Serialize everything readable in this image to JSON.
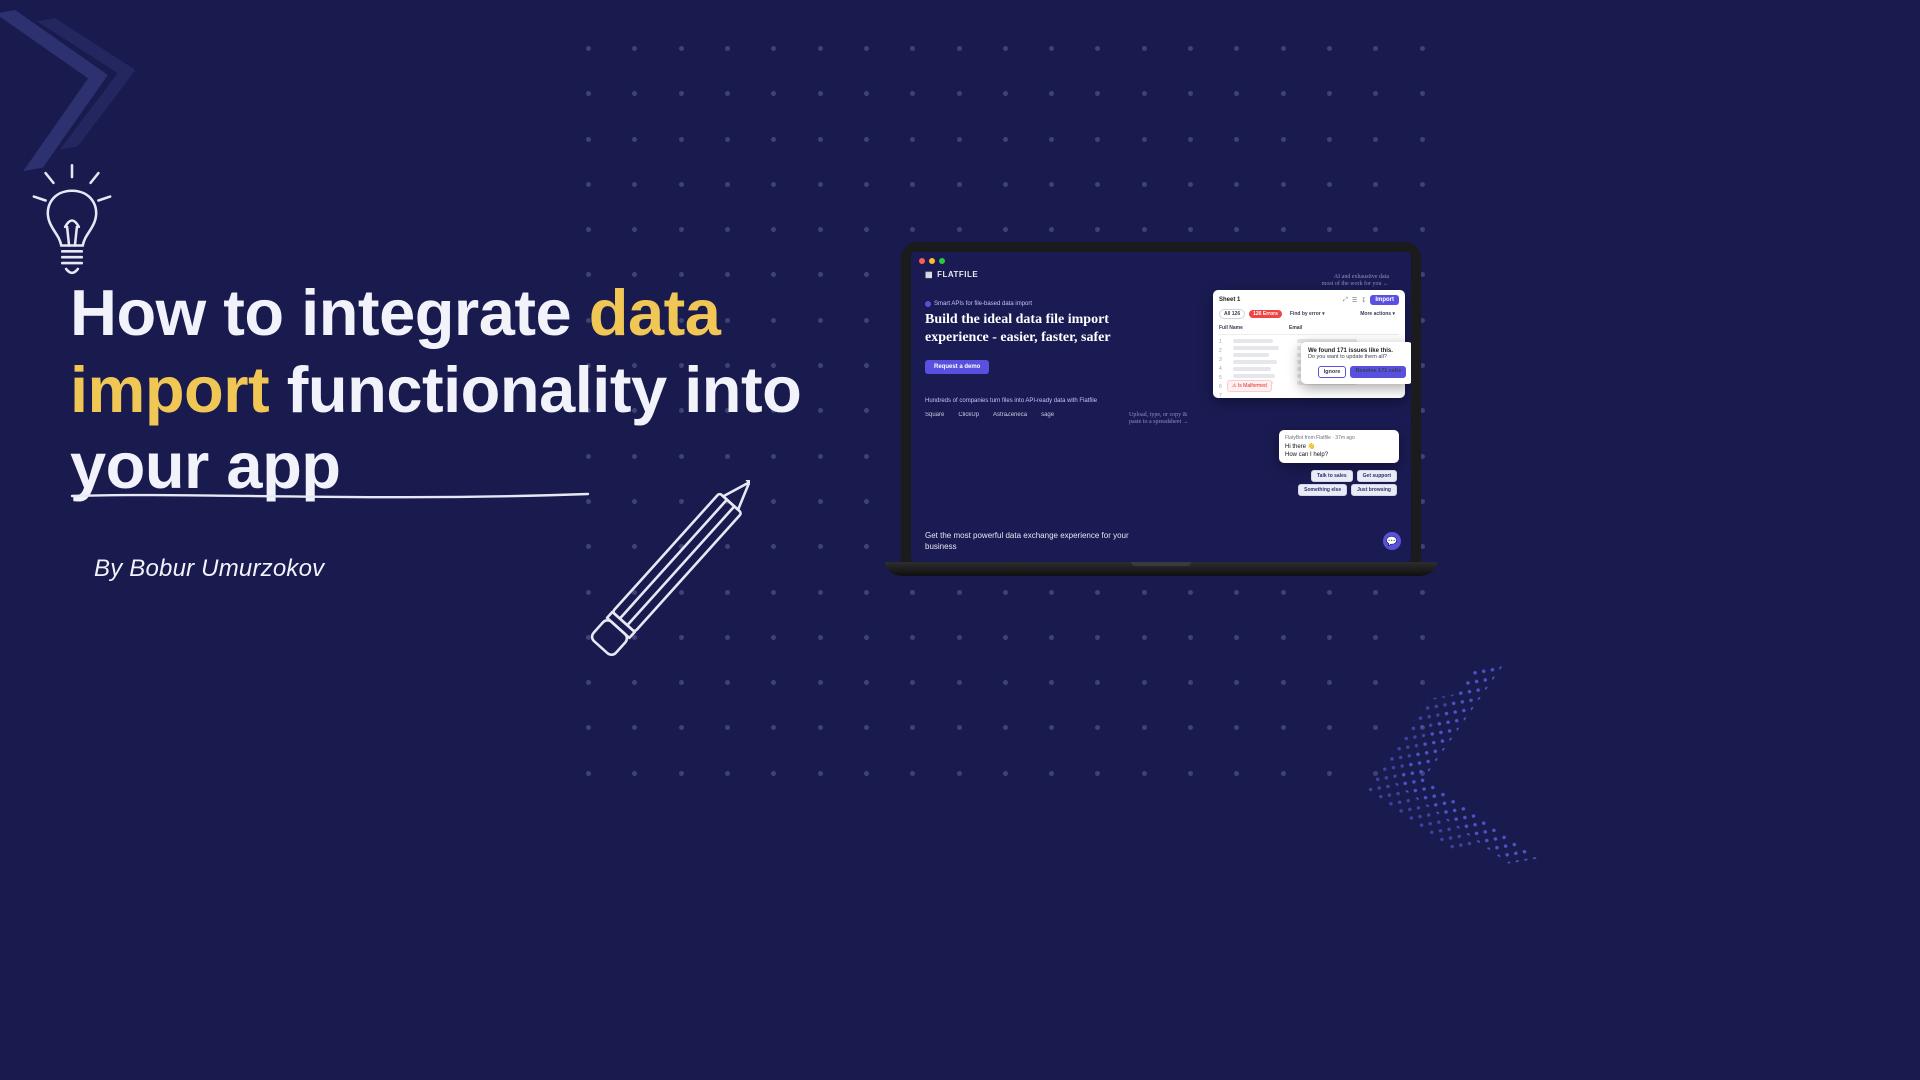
{
  "headline": {
    "part1": "How to integrate ",
    "accent": "data import",
    "part2": " functionality into your app"
  },
  "byline": "By Bobur Umurzokov",
  "laptop": {
    "brand": "FLATFILE",
    "tagline": "Smart APIs for file-based data import",
    "hero": "Build the ideal data file import experience - easier, faster, safer",
    "ctaLabel": "Request a demo",
    "subline": "Hundreds of companies turn files into API-ready data with Flatfile",
    "logos": [
      "Square",
      "ClickUp",
      "AstraZeneca",
      "sage"
    ],
    "section2": "Get the most powerful data exchange experience for your business",
    "sheet": {
      "title": "Sheet 1",
      "importLabel": "Import",
      "errorsPill": "126 Errors",
      "findLabel": "Find by error",
      "moreLabel": "More actions",
      "col1": "Full Name",
      "col2": "Email",
      "warning": "Is Malformed"
    },
    "fix": {
      "title": "We found 171 issues like this.",
      "question": "Do you want to update them all?",
      "ignore": "Ignore",
      "resolve": "Resolve 171 cells"
    },
    "chat": {
      "meta": "FlatyBot from Flatfile · 37m ago",
      "line1": "Hi there 👋",
      "line2": "How can I help?"
    },
    "chips": [
      "Talk to sales",
      "Get support",
      "Something else",
      "Just browsing"
    ],
    "notes": {
      "top": "AI and exhaustive data\nmost of the work for you ←",
      "mid": "Upload, type, or copy &\npaste to a spreadsheet →"
    }
  }
}
